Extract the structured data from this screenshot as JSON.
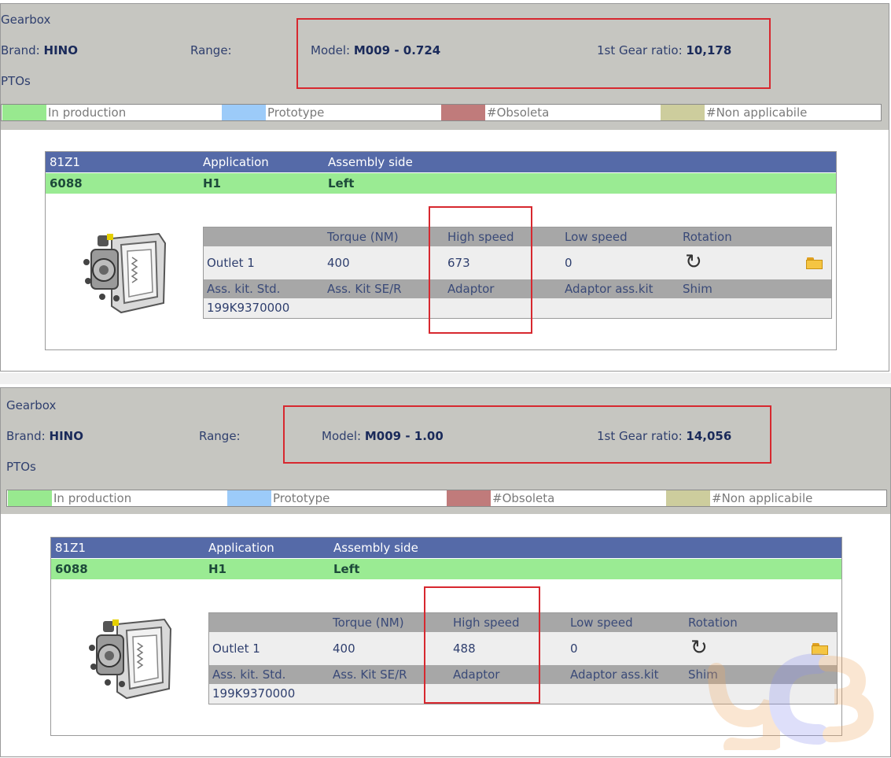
{
  "entries": [
    {
      "header": {
        "section_title": "Gearbox",
        "brand_label": "Brand:",
        "brand_value": "HINO",
        "range_label": "Range:",
        "model_label": "Model:",
        "model_value": "M009 - 0.724",
        "ratio_label": "1st Gear ratio:",
        "ratio_value": "10,178",
        "ptos_label": "PTOs"
      },
      "legend": [
        "In production",
        "Prototype",
        "#Obsoleta",
        "#Non applicabile"
      ],
      "card": {
        "columns": [
          "81Z1",
          "Application",
          "Assembly side"
        ],
        "values": [
          "6088",
          "H1",
          "Left"
        ],
        "spec_headers": [
          "",
          "Torque (NM)",
          "High speed",
          "Low speed",
          "Rotation"
        ],
        "outlet": [
          "Outlet 1",
          "400",
          "673",
          "0"
        ],
        "kit_headers": [
          "Ass. kit. Std.",
          "Ass. Kit SE/R",
          "Adaptor",
          "Adaptor ass.kit",
          "Shim"
        ],
        "kit_values": [
          "199K9370000"
        ]
      }
    },
    {
      "header": {
        "section_title": "Gearbox",
        "brand_label": "Brand:",
        "brand_value": "HINO",
        "range_label": "Range:",
        "model_label": "Model:",
        "model_value": "M009 - 1.00",
        "ratio_label": "1st Gear ratio:",
        "ratio_value": "14,056",
        "ptos_label": "PTOs"
      },
      "legend": [
        "In production",
        "Prototype",
        "#Obsoleta",
        "#Non applicabile"
      ],
      "card": {
        "columns": [
          "81Z1",
          "Application",
          "Assembly side"
        ],
        "values": [
          "6088",
          "H1",
          "Left"
        ],
        "spec_headers": [
          "",
          "Torque (NM)",
          "High speed",
          "Low speed",
          "Rotation"
        ],
        "outlet": [
          "Outlet 1",
          "400",
          "488",
          "0"
        ],
        "kit_headers": [
          "Ass. kit. Std.",
          "Ass. Kit SE/R",
          "Adaptor",
          "Adaptor ass.kit",
          "Shim"
        ],
        "kit_values": [
          "199K9370000"
        ]
      }
    }
  ],
  "colors": {
    "in_production": "#98e98f",
    "prototype": "#9ccbf9",
    "obsoleta": "#c07b7b",
    "non_applicabile": "#cdcd9d",
    "header_bar": "#556aa8",
    "highlight_box": "#d7282f"
  },
  "icons": {
    "rotation": "clockwise-rotation-icon",
    "folder": "open-folder-icon"
  }
}
